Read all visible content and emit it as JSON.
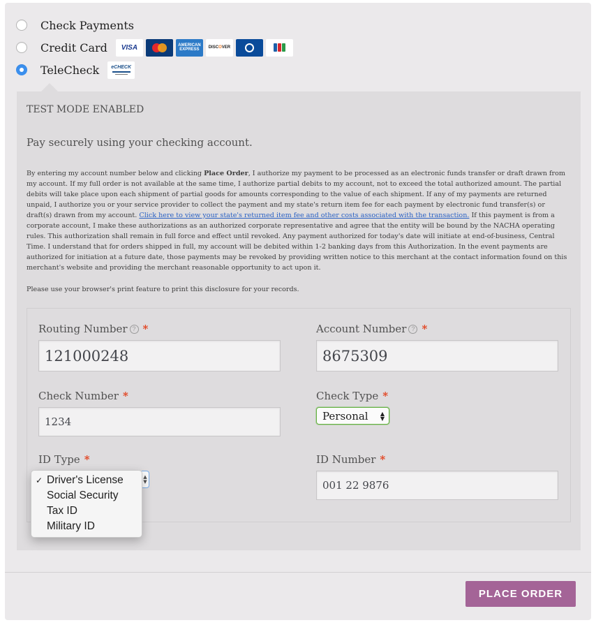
{
  "payment_methods": [
    {
      "label": "Check Payments",
      "selected": false
    },
    {
      "label": "Credit Card",
      "selected": false,
      "cards": [
        "visa-icon",
        "mastercard-icon",
        "amex-icon",
        "discover-icon",
        "diners-club-icon",
        "jcb-icon"
      ]
    },
    {
      "label": "TeleCheck",
      "selected": true,
      "logo": "echeck-icon"
    }
  ],
  "cards": {
    "visa": "VISA",
    "amex": "AMERICAN EXPRESS",
    "discover_prefix": "DISC",
    "discover_mid": "O",
    "discover_suffix": "VER",
    "echeck": "eCHECK"
  },
  "panel": {
    "test_mode": "TEST MODE ENABLED",
    "description": "Pay securely using your checking account.",
    "authorization": {
      "part1": "By entering my account number below and clicking ",
      "bold": "Place Order",
      "part2": ", I authorize my payment to be processed as an electronic funds transfer or draft drawn from my account. If my full order is not available at the same time, I authorize partial debits to my account, not to exceed the total authorized amount. The partial debits will take place upon each shipment of partial goods for amounts corresponding to the value of each shipment. If any of my payments are returned unpaid, I authorize you or your service provider to collect the payment and my state's return item fee for each payment by electronic fund transfer(s) or draft(s) drawn from my account. ",
      "link": "Click here to view your state's returned item fee and other costs associated with the transaction.",
      "part3": " If this payment is from a corporate account, I make these authorizations as an authorized corporate representative and agree that the entity will be bound by the NACHA operating rules. This authorization shall remain in full force and effect until revoked. Any payment authorized for today's date will initiate at end-of-business, Central Time. I understand that for orders shipped in full, my account will be debited within 1-2 banking days from this Authorization. In the event payments are authorized for initiation at a future date, those payments may be revoked by providing written notice to this merchant at the contact information found on this merchant's website and providing the merchant reasonable opportunity to act upon it."
    },
    "print_note": "Please use your browser's print feature to print this disclosure for your records."
  },
  "form": {
    "routing": {
      "label": "Routing Number",
      "help": "?",
      "required": "*",
      "value": "121000248"
    },
    "account": {
      "label": "Account Number",
      "help": "?",
      "required": "*",
      "value": "8675309"
    },
    "check_number": {
      "label": "Check Number",
      "required": "*",
      "value": "1234"
    },
    "check_type": {
      "label": "Check Type",
      "required": "*",
      "value": "Personal"
    },
    "id_type": {
      "label": "ID Type",
      "required": "*",
      "options": [
        "Driver's License",
        "Social Security",
        "Tax ID",
        "Military ID"
      ],
      "selected": "Driver's License",
      "check_mark": "✓"
    },
    "id_number": {
      "label": "ID Number",
      "required": "*",
      "value": "001 22 9876"
    }
  },
  "actions": {
    "place_order": "PLACE ORDER"
  },
  "colors": {
    "accent": "#a46497",
    "radio_selected": "#3b8fed",
    "required": "#e2401c",
    "link": "#2a61c4"
  }
}
